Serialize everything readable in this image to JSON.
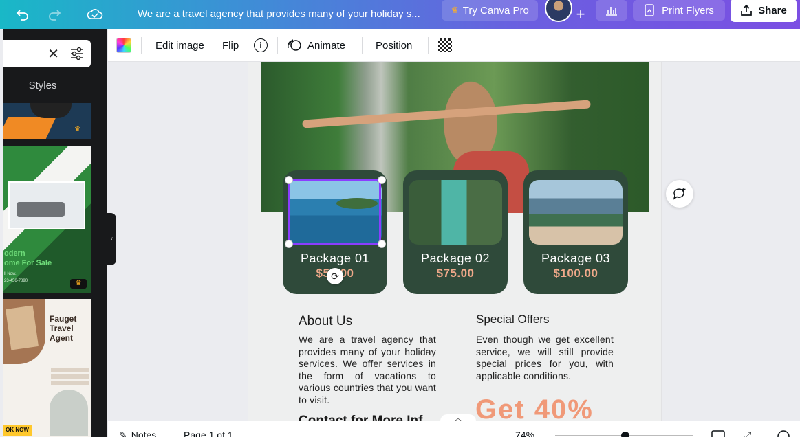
{
  "topbar": {
    "doc_title": "We are a travel agency that provides many of your holiday s...",
    "try_pro_label": "Try Canva Pro",
    "print_label": "Print Flyers",
    "share_label": "Share",
    "crown_icon": "crown-icon",
    "undo_icon": "undo-icon",
    "redo_icon": "redo-icon",
    "cloud_icon": "cloud-saved-icon"
  },
  "left_panel": {
    "styles_label": "Styles",
    "thumb2_line1": "odern",
    "thumb2_line2": "ome For Sale",
    "thumb2_line3": "ll Now.",
    "thumb2_line4": "23-456-7890",
    "thumb3_title": "Fauget Travel Agent",
    "thumb3_cta": "OK NOW"
  },
  "toolbar": {
    "edit_image": "Edit image",
    "flip": "Flip",
    "info": "i",
    "animate": "Animate",
    "position": "Position"
  },
  "page": {
    "packages": [
      {
        "title": "Package 01",
        "price": "$50.00"
      },
      {
        "title": "Package 02",
        "price": "$75.00"
      },
      {
        "title": "Package 03",
        "price": "$100.00"
      }
    ],
    "about_heading": "About Us",
    "about_text": "We are a travel agency that provides many of your holiday services. We offer services in the form of vacations to various countries that you want to visit.",
    "offers_heading": "Special Offers",
    "offers_text": "Even though we get excellent service, we will still provide special prices for you, with applicable conditions.",
    "big_offer": "Get 40%",
    "contact_heading_partial": "Contact for More Inf"
  },
  "bottombar": {
    "notes_label": "Notes",
    "page_label": "Page 1 of 1",
    "zoom": "74%"
  },
  "colors": {
    "accent": "#8b3dff",
    "card_bg": "#2f4a3a",
    "price": "#f0a98a",
    "offer": "#f09978"
  }
}
